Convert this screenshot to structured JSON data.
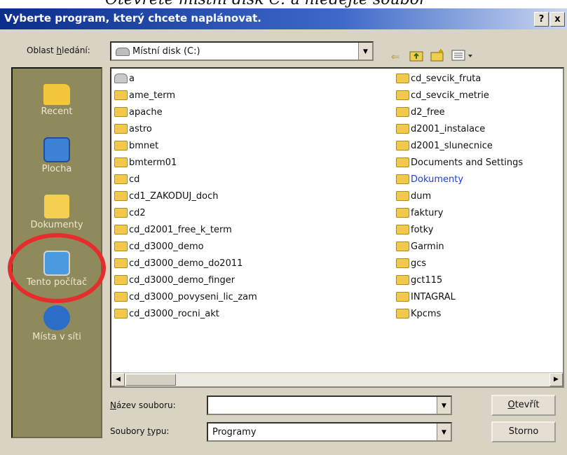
{
  "page_caption": "Otevřete místní disk C: a hledejte soubor",
  "window": {
    "title": "Vyberte program, který chcete naplánovat.",
    "help_label": "?",
    "close_label": "x"
  },
  "lookin": {
    "label_pre": "Oblast ",
    "label_u": "h",
    "label_post": "ledání:",
    "value": "Místní disk (C:)"
  },
  "toolbar_icons": [
    "back-icon",
    "up-folder-icon",
    "new-folder-icon",
    "view-menu-icon"
  ],
  "places": [
    {
      "name": "recent",
      "label": "Recent",
      "icon": "recent-folder-icon",
      "color": "#f3c63b"
    },
    {
      "name": "desktop",
      "label": "Plocha",
      "icon": "desktop-icon",
      "color": "#3d82d6"
    },
    {
      "name": "documents",
      "label": "Dokumenty",
      "icon": "documents-folder-icon",
      "color": "#f4cf52"
    },
    {
      "name": "computer",
      "label": "Tento počítač",
      "icon": "computer-icon",
      "color": "#4a9ae0"
    },
    {
      "name": "network",
      "label": "Místa v síti",
      "icon": "network-icon",
      "color": "#2b6dc9"
    }
  ],
  "files_col1": [
    {
      "name": "a",
      "icon": "drive-icon"
    },
    {
      "name": "ame_term",
      "icon": "folder-icon"
    },
    {
      "name": "apache",
      "icon": "folder-icon"
    },
    {
      "name": "astro",
      "icon": "folder-icon"
    },
    {
      "name": "bmnet",
      "icon": "folder-icon"
    },
    {
      "name": "bmterm01",
      "icon": "folder-icon"
    },
    {
      "name": "cd",
      "icon": "folder-icon"
    },
    {
      "name": "cd1_ZAKODUJ_doch",
      "icon": "folder-icon"
    },
    {
      "name": "cd2",
      "icon": "folder-icon"
    },
    {
      "name": "cd_d2001_free_k_term",
      "icon": "folder-icon"
    },
    {
      "name": "cd_d3000_demo",
      "icon": "folder-icon"
    },
    {
      "name": "cd_d3000_demo_do2011",
      "icon": "folder-icon"
    },
    {
      "name": "cd_d3000_demo_finger",
      "icon": "folder-icon"
    },
    {
      "name": "cd_d3000_povyseni_lic_zam",
      "icon": "folder-icon"
    },
    {
      "name": "cd_d3000_rocni_akt",
      "icon": "folder-icon"
    }
  ],
  "files_col2": [
    {
      "name": "cd_sevcik_fruta",
      "icon": "folder-icon"
    },
    {
      "name": "cd_sevcik_metrie",
      "icon": "folder-icon"
    },
    {
      "name": "d2_free",
      "icon": "folder-icon"
    },
    {
      "name": "d2001_instalace",
      "icon": "folder-icon"
    },
    {
      "name": "d2001_slunecnice",
      "icon": "folder-icon"
    },
    {
      "name": "Documents and Settings",
      "icon": "folder-icon"
    },
    {
      "name": "Dokumenty",
      "icon": "folder-icon"
    },
    {
      "name": "dum",
      "icon": "folder-icon"
    },
    {
      "name": "faktury",
      "icon": "folder-icon"
    },
    {
      "name": "fotky",
      "icon": "folder-icon"
    },
    {
      "name": "Garmin",
      "icon": "folder-icon"
    },
    {
      "name": "gcs",
      "icon": "folder-icon"
    },
    {
      "name": "gct115",
      "icon": "folder-icon"
    },
    {
      "name": "INTAGRAL",
      "icon": "folder-icon"
    },
    {
      "name": "Kpcms",
      "icon": "folder-icon"
    }
  ],
  "filename": {
    "label_pre": "",
    "label_u": "N",
    "label_post": "ázev souboru:",
    "value": ""
  },
  "filetype": {
    "label_pre": "Soubory ",
    "label_u": "t",
    "label_post": "ypu:",
    "value": "Programy"
  },
  "buttons": {
    "open_u": "O",
    "open_rest": "tevřít",
    "cancel": "Storno"
  },
  "colors": {
    "titlebar": "#0b2d8c",
    "places_bar": "#8e8a5c",
    "highlight_circle": "#e52d2d",
    "special_folder_text": "#1d3fe0"
  }
}
